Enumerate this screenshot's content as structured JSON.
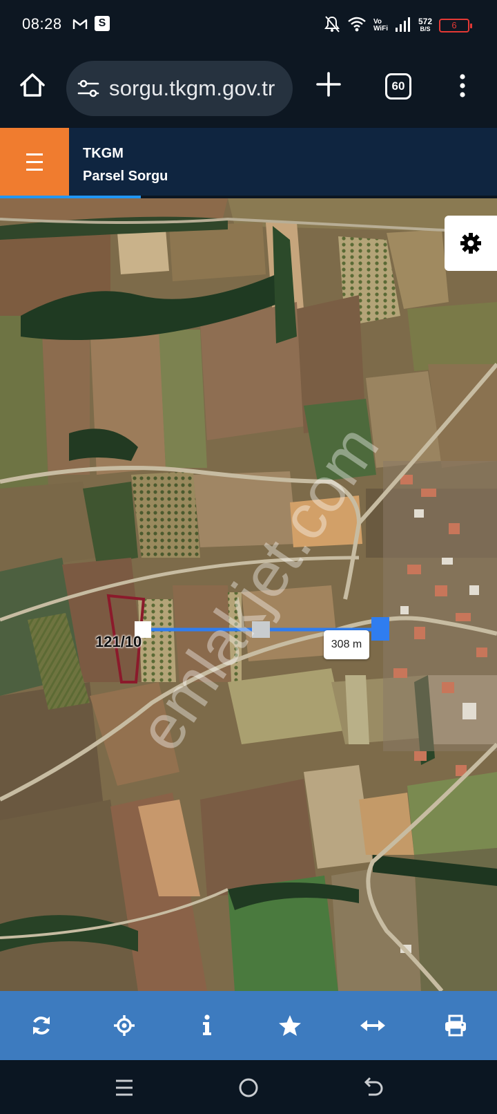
{
  "status_bar": {
    "time": "08:28",
    "icons": [
      "gmail-icon",
      "s-app-icon",
      "mute-icon",
      "wifi-icon",
      "signal-icon",
      "battery-icon"
    ],
    "vowifi_line1": "Vo",
    "vowifi_line2": "WiFi",
    "net_speed_value": "572",
    "net_speed_unit": "B/S",
    "battery_level": "6",
    "battery_color": "#e53935"
  },
  "browser": {
    "url": "sorgu.tkgm.gov.tr",
    "tab_count": "60"
  },
  "app": {
    "title": "TKGM",
    "subtitle": "Parsel Sorgu",
    "accent_color": "#f07c2f",
    "header_color": "#0f2540"
  },
  "map": {
    "parcel_label": "121/10",
    "distance_label": "308 m",
    "watermark": "emlakjet.com",
    "parcel_outline_color": "#8b1a2b",
    "measure_line_color": "#2f7df0"
  },
  "toolbar": {
    "color": "#3d7bbf",
    "buttons": [
      {
        "name": "refresh-icon"
      },
      {
        "name": "locate-icon"
      },
      {
        "name": "info-icon"
      },
      {
        "name": "star-icon"
      },
      {
        "name": "measure-icon"
      },
      {
        "name": "print-icon"
      }
    ]
  },
  "system_nav": {
    "buttons": [
      "recents-icon",
      "home-circle-icon",
      "back-icon"
    ]
  }
}
